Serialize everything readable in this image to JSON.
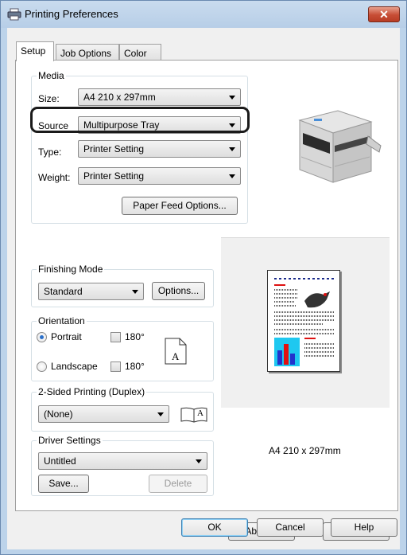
{
  "window": {
    "title": "Printing Preferences",
    "close_glyph": "✕"
  },
  "tabs": [
    {
      "label": "Setup",
      "active": true
    },
    {
      "label": "Job Options",
      "active": false
    },
    {
      "label": "Color",
      "active": false
    }
  ],
  "media": {
    "group_label": "Media",
    "size_label": "Size:",
    "size_value": "A4 210 x 297mm",
    "source_label": "Source",
    "source_value": "Multipurpose Tray",
    "type_label": "Type:",
    "type_value": "Printer Setting",
    "weight_label": "Weight:",
    "weight_value": "Printer Setting",
    "paper_feed_button": "Paper Feed Options..."
  },
  "finishing": {
    "group_label": "Finishing Mode",
    "value": "Standard",
    "options_button": "Options..."
  },
  "orientation": {
    "group_label": "Orientation",
    "portrait_label": "Portrait",
    "portrait_checked": true,
    "landscape_label": "Landscape",
    "landscape_checked": false,
    "rotate_label_1": "180°",
    "rotate_label_2": "180°",
    "page_letter": "A"
  },
  "duplex": {
    "group_label": "2-Sided Printing (Duplex)",
    "value": "(None)",
    "book_letter": "A"
  },
  "driver_settings": {
    "group_label": "Driver Settings",
    "value": "Untitled",
    "save_button": "Save...",
    "delete_button": "Delete"
  },
  "preview": {
    "caption": "A4 210 x 297mm"
  },
  "buttons": {
    "about": "About...",
    "default": "Default",
    "ok": "OK",
    "cancel": "Cancel",
    "help": "Help"
  },
  "icons": [
    "printer-icon",
    "close-icon",
    "printer-image",
    "portrait-page-icon",
    "duplex-book-icon",
    "page-preview-image"
  ],
  "colors": {
    "title_bar": "#bcd3ea",
    "close_button": "#c74d35",
    "radio_accent": "#2a6fc9"
  }
}
